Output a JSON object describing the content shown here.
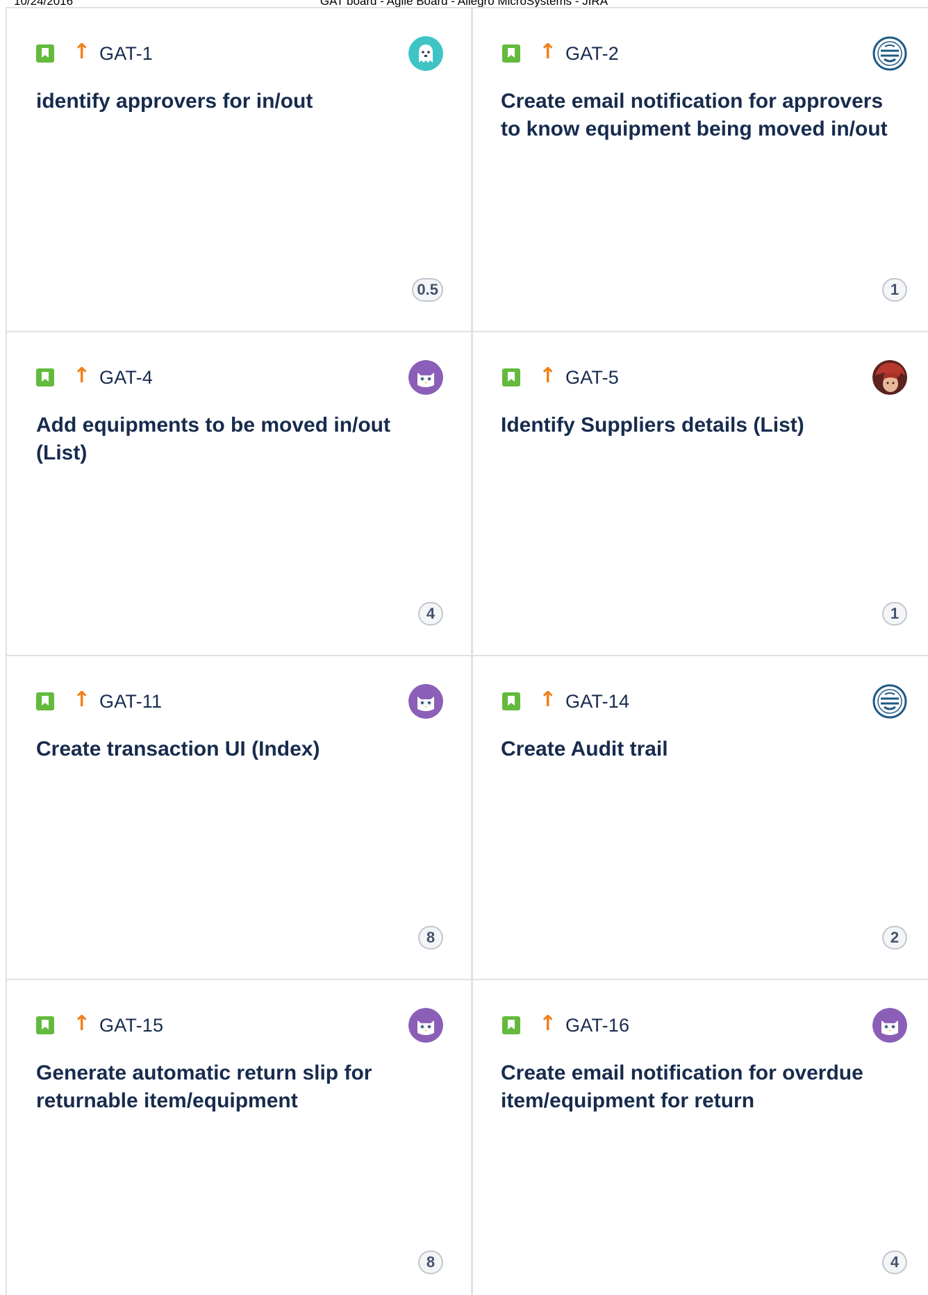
{
  "print_header": {
    "date": "10/24/2016",
    "title": "GAT board - Agile Board - Allegro MicroSystems - JIRA"
  },
  "icons": {
    "issue_type": "story-bookmark-icon",
    "priority": "arrow-up-priority-icon"
  },
  "colors": {
    "story_green": "#63ba3c",
    "priority_orange": "#f0801c",
    "text_dark": "#172b4d",
    "border_gray": "#dfe1e6"
  },
  "cards": [
    {
      "key": "GAT-1",
      "summary": "identify approvers for in/out",
      "estimate": "0.5",
      "avatar": "teal-ghost-avatar"
    },
    {
      "key": "GAT-2",
      "summary": "Create email notification for approvers to know equipment being moved in/out",
      "estimate": "1",
      "avatar": "blue-seal-avatar"
    },
    {
      "key": "GAT-4",
      "summary": "Add equipments to be moved in/out (List)",
      "estimate": "4",
      "avatar": "purple-owl-avatar"
    },
    {
      "key": "GAT-5",
      "summary": "Identify Suppliers details (List)",
      "estimate": "1",
      "avatar": "red-hair-photo-avatar"
    },
    {
      "key": "GAT-11",
      "summary": "Create transaction UI (Index)",
      "estimate": "8",
      "avatar": "purple-owl-avatar"
    },
    {
      "key": "GAT-14",
      "summary": "Create Audit trail",
      "estimate": "2",
      "avatar": "blue-seal-avatar"
    },
    {
      "key": "GAT-15",
      "summary": "Generate automatic return slip for returnable item/equipment",
      "estimate": "8",
      "avatar": "purple-owl-avatar"
    },
    {
      "key": "GAT-16",
      "summary": "Create email notification for overdue item/equipment for return",
      "estimate": "4",
      "avatar": "purple-owl-avatar"
    }
  ]
}
